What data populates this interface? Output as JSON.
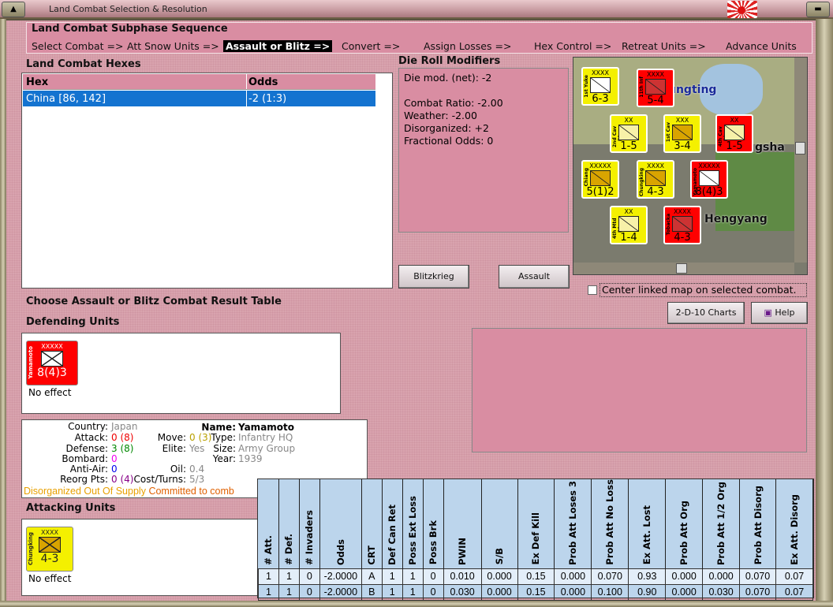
{
  "window": {
    "title": "Land Combat Selection & Resolution"
  },
  "subphase": {
    "title": "Land Combat Subphase Sequence",
    "steps": [
      "Select Combat =>",
      "Att Snow Units =>",
      "Assault or Blitz =>",
      "Convert =>",
      "Assign Losses =>",
      "Hex Control =>",
      "Retreat Units =>",
      "Advance Units"
    ],
    "active_index": 2
  },
  "hexes": {
    "title": "Land Combat Hexes",
    "columns": [
      "Hex",
      "Odds"
    ],
    "rows": [
      {
        "hex": "China [86, 142]",
        "odds": "-2 (1:3)",
        "selected": true
      }
    ]
  },
  "drm": {
    "title": "Die Roll Modifiers",
    "lines": [
      "Die mod. (net): -2",
      "",
      "Combat Ratio: -2.00",
      "Weather: -2.00",
      "Disorganized: +2",
      "Fractional Odds: 0"
    ]
  },
  "map": {
    "labels": [
      "ungting",
      "gsha",
      "Hengyang"
    ],
    "units": [
      {
        "size": "XXXX",
        "name": "1st Yuke",
        "str": "6-3",
        "color": "#f4f000",
        "sym": "#fff"
      },
      {
        "size": "XXXX",
        "name": "11th Inf",
        "str": "5-4",
        "color": "#f00",
        "sym": "#c33"
      },
      {
        "size": "XX",
        "name": "2nd Cav Div",
        "str": "1-5",
        "color": "#f4f000",
        "sym": "#f7f1a8"
      },
      {
        "size": "XXX",
        "name": "1st Cav",
        "str": "3-4",
        "color": "#f4f000",
        "sym": "#d9a400"
      },
      {
        "size": "XX",
        "name": "4th Cav Div",
        "str": "1-5",
        "color": "#f00",
        "sym": "#f7f1a8"
      },
      {
        "size": "XXXXX",
        "name": "Chiang",
        "str": "5(1)2",
        "color": "#f4f000",
        "sym": "#d9a400"
      },
      {
        "size": "XXXX",
        "name": "Chungking",
        "str": "4-3",
        "color": "#f4f000",
        "sym": "#d9a400"
      },
      {
        "size": "XXXXX",
        "name": "Yamamoto",
        "str": "8(4)3",
        "color": "#f00",
        "sym": "#fff"
      },
      {
        "size": "XX",
        "name": "4th Mtd Div",
        "str": "1-4",
        "color": "#f4f000",
        "sym": "#f7f1a8"
      },
      {
        "size": "XXXX",
        "name": "Tobacka",
        "str": "4-3",
        "color": "#f00",
        "sym": "#c33"
      }
    ]
  },
  "buttons": {
    "blitzkrieg": "Blitzkrieg",
    "assault": "Assault",
    "charts": "2-D-10 Charts",
    "help": "Help"
  },
  "center_linked": {
    "label": "Center linked map on selected combat.",
    "checked": false
  },
  "crt_choose_label": "Choose Assault or Blitz Combat Result Table",
  "defending": {
    "title": "Defending Units",
    "unit": {
      "size": "XXXXX",
      "name": "Yamamoto",
      "str": "8(4)3",
      "color": "#f00"
    },
    "result": "No effect"
  },
  "attacking": {
    "title": "Attacking Units",
    "unit": {
      "size": "XXXX",
      "name": "Chungking",
      "str": "4-3",
      "color": "#f4f000"
    },
    "result": "No effect"
  },
  "info": {
    "country_l": "Country:",
    "country": "Japan",
    "attack_l": "Attack:",
    "attack": "0 (8)",
    "defense_l": "Defense:",
    "defense": "3 (8)",
    "bombard_l": "Bombard:",
    "bombard": "0",
    "antiair_l": "Anti-Air:",
    "antiair": "0",
    "reorg_l": "Reorg Pts:",
    "reorg": "0 (4)",
    "move_l": "Move:",
    "move": "0 (3)",
    "elite_l": "Elite:",
    "elite": "Yes",
    "oil_l": "Oil:",
    "oil": "0.4",
    "cost_l": "Cost/Turns:",
    "cost": "5/3",
    "name_l": "Name:",
    "name": "Yamamoto",
    "type_l": "Type:",
    "type": "Infantry HQ",
    "size_l": "Size:",
    "size": "Army Group",
    "year_l": "Year:",
    "year": "1939",
    "status1": "Disorganized Out Of Supply",
    "status2": "Committed to comb"
  },
  "crt": {
    "columns": [
      "# Att.",
      "# Def.",
      "# Invaders",
      "Odds",
      "CRT",
      "Def Can Ret",
      "Poss Ext Loss",
      "Poss Brk",
      "PWIN",
      "S/B",
      "Ex Def Kill",
      "Prob Att Loses 3",
      "Prob Att No Loss",
      "Ex Att. Lost",
      "Prob Att Org",
      "Prob Att 1/2 Org",
      "Prob Att Disorg",
      "Ex Att. Disorg"
    ],
    "rows": [
      [
        "1",
        "1",
        "0",
        "-2.0000",
        "A",
        "1",
        "1",
        "0",
        "0.010",
        "0.000",
        "0.15",
        "0.000",
        "0.070",
        "0.93",
        "0.000",
        "0.000",
        "0.070",
        "0.07"
      ],
      [
        "1",
        "1",
        "0",
        "-2.0000",
        "B",
        "1",
        "1",
        "0",
        "0.030",
        "0.000",
        "0.15",
        "0.000",
        "0.100",
        "0.90",
        "0.000",
        "0.030",
        "0.070",
        "0.07"
      ]
    ]
  }
}
